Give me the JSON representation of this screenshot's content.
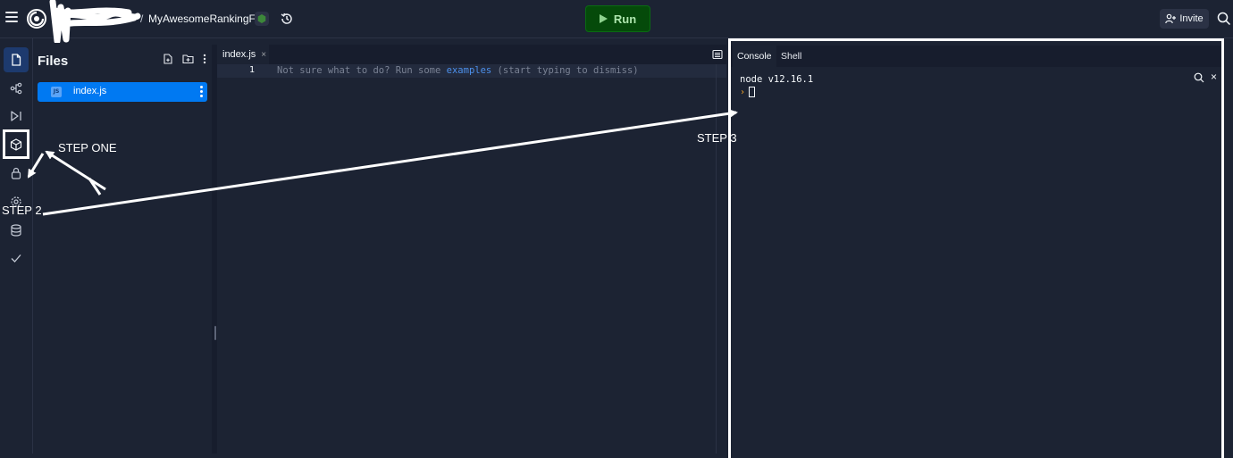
{
  "topbar": {
    "project_separator": "/",
    "project_name": "MyAwesomeRankingF...",
    "run_label": "Run",
    "invite_label": "Invite"
  },
  "files": {
    "title": "Files",
    "items": [
      {
        "name": "index.js",
        "badge": "JS"
      }
    ]
  },
  "editor": {
    "tab_label": "index.js",
    "tab_close": "×",
    "line_number": "1",
    "hint_before": "Not sure what to do? Run some ",
    "hint_link": "examples",
    "hint_after": " (start typing to dismiss)"
  },
  "console": {
    "tabs": [
      "Console",
      "Shell"
    ],
    "output": "node v12.16.1",
    "prompt": "›",
    "close": "×"
  },
  "annotations": {
    "step_one": "STEP ONE",
    "step_two": "STEP 2",
    "step_three": "STEP 3"
  },
  "colors": {
    "background": "#1c2333",
    "accent": "#0079f2",
    "run_bg": "#054a0a",
    "run_text": "#aee6ae"
  }
}
